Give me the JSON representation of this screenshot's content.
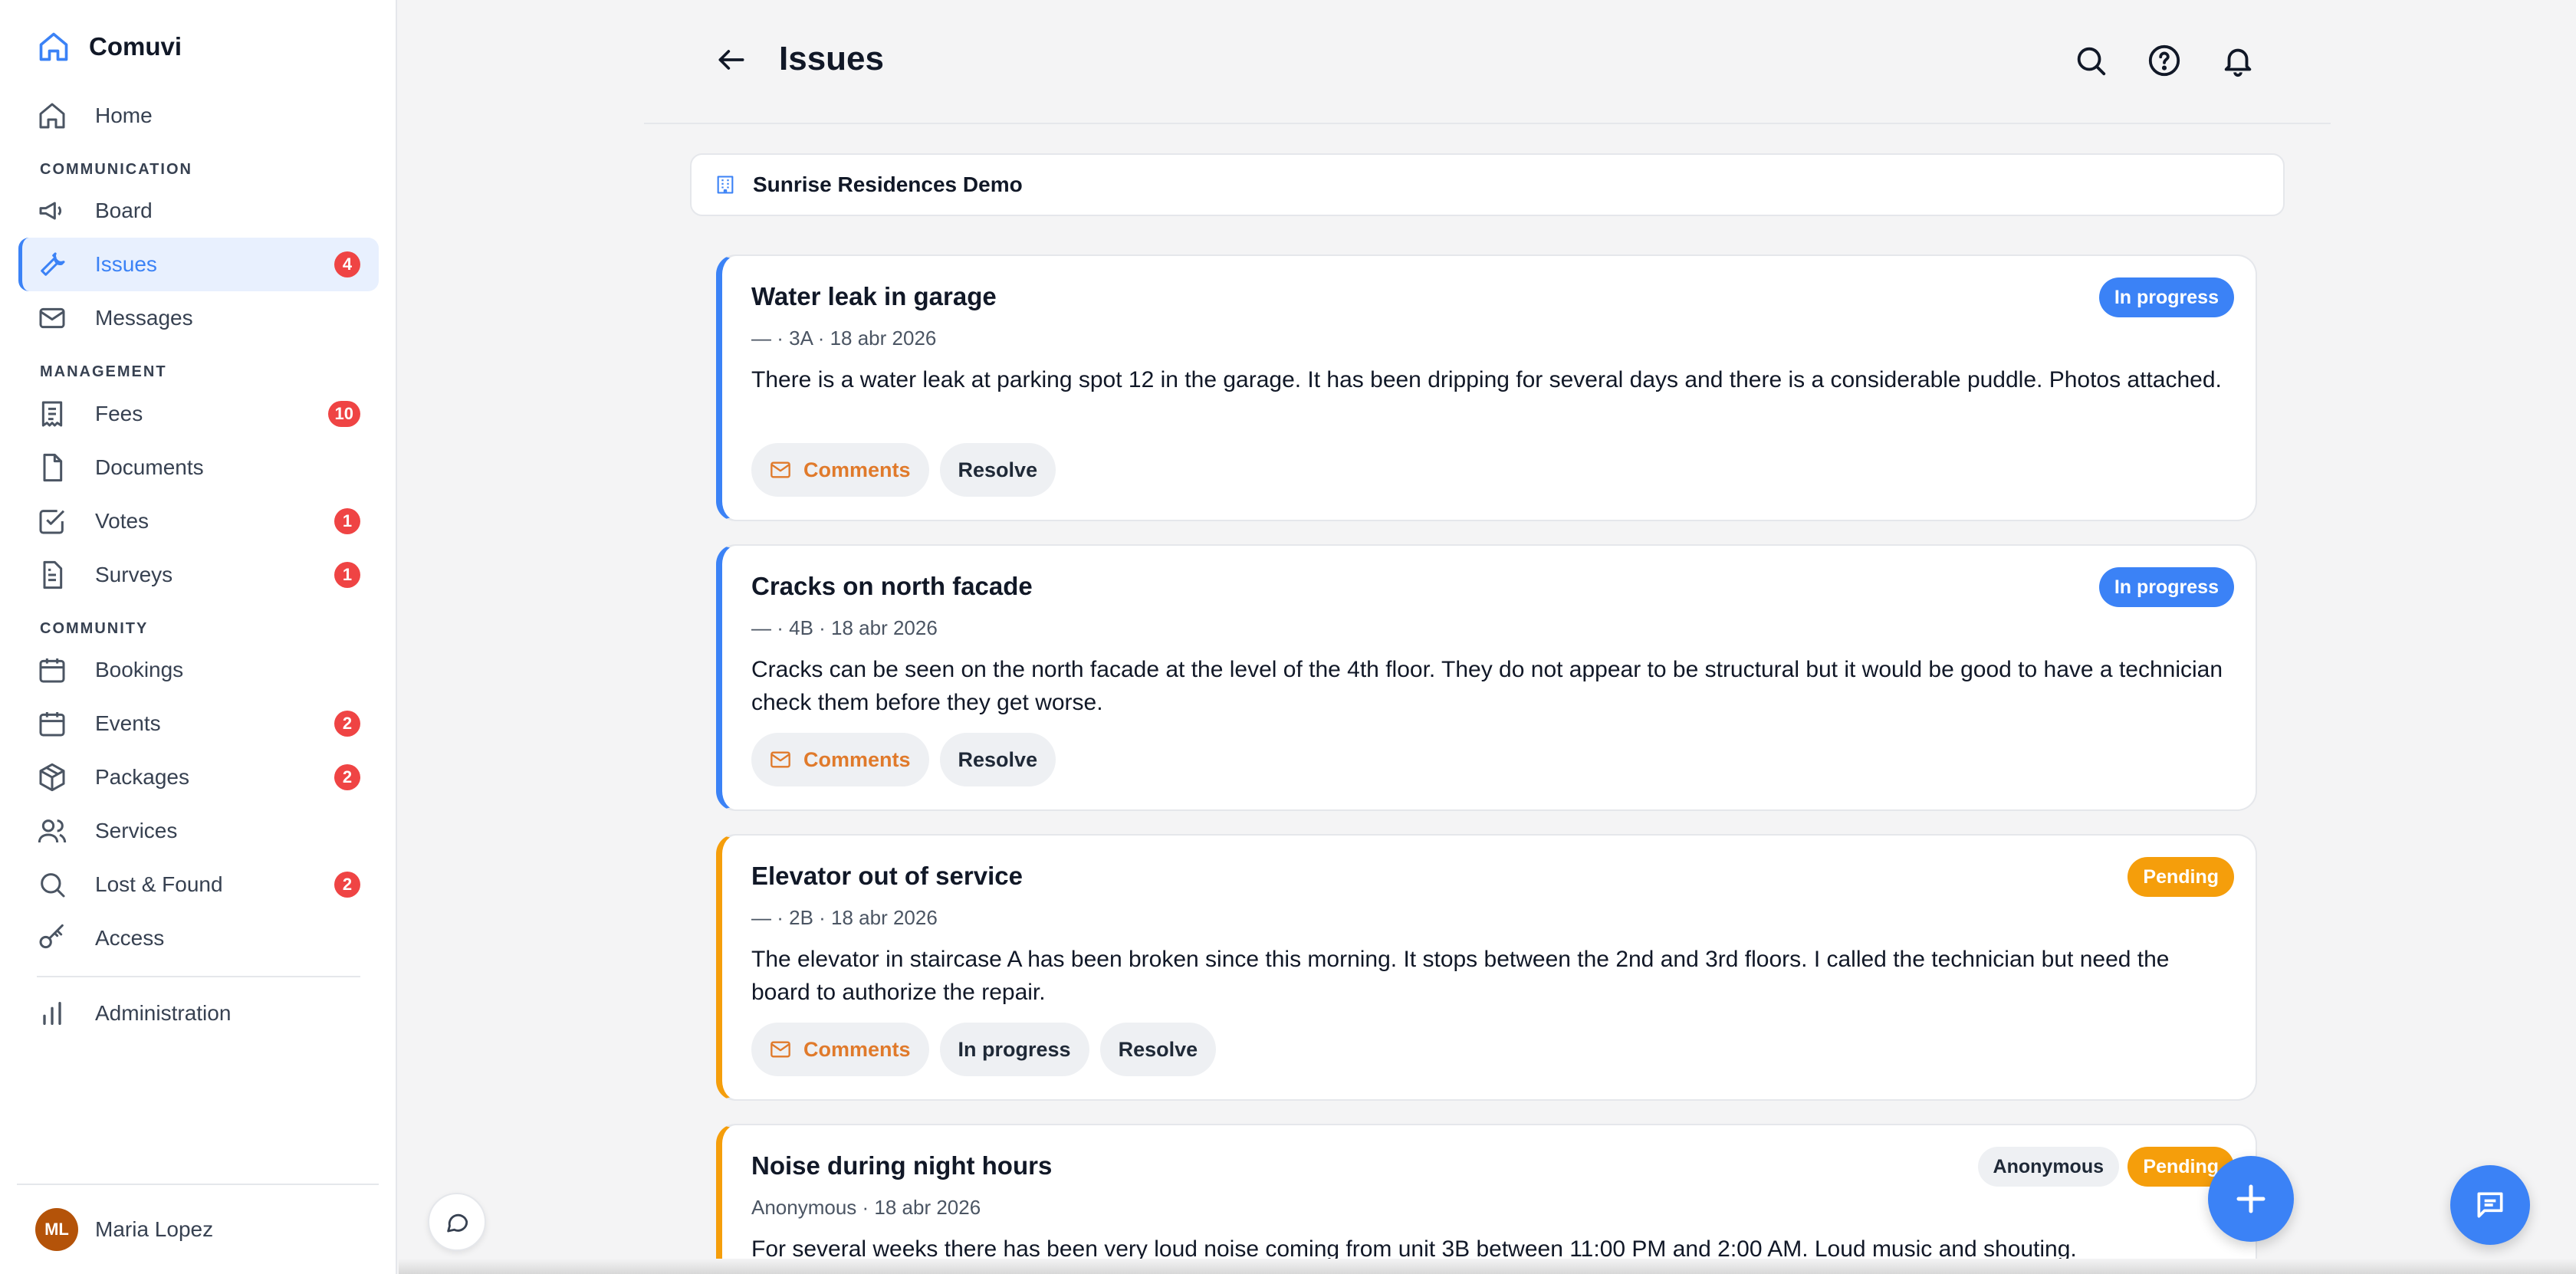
{
  "app": {
    "name": "Comuvi"
  },
  "sidebar": {
    "home": {
      "label": "Home"
    },
    "sections": {
      "communication": "COMMUNICATION",
      "management": "MANAGEMENT",
      "community": "COMMUNITY"
    },
    "items": {
      "board": {
        "label": "Board"
      },
      "issues": {
        "label": "Issues",
        "badge": "4"
      },
      "messages": {
        "label": "Messages"
      },
      "fees": {
        "label": "Fees",
        "badge": "10"
      },
      "documents": {
        "label": "Documents"
      },
      "votes": {
        "label": "Votes",
        "badge": "1"
      },
      "surveys": {
        "label": "Surveys",
        "badge": "1"
      },
      "bookings": {
        "label": "Bookings"
      },
      "events": {
        "label": "Events",
        "badge": "2"
      },
      "packages": {
        "label": "Packages",
        "badge": "2"
      },
      "services": {
        "label": "Services"
      },
      "lostfound": {
        "label": "Lost & Found",
        "badge": "2"
      },
      "access": {
        "label": "Access"
      },
      "administration": {
        "label": "Administration"
      }
    },
    "user": {
      "initials": "ML",
      "name": "Maria Lopez"
    }
  },
  "header": {
    "title": "Issues"
  },
  "community": {
    "name": "Sunrise Residences Demo"
  },
  "issues": [
    {
      "title": "Water leak in garage",
      "meta": "— · 3A · 18 abr 2026",
      "description": "There is a water leak at parking spot 12 in the garage. It has been dripping for several days and there is a considerable puddle. Photos attached.",
      "status": "In progress",
      "actions": {
        "comments": "Comments",
        "resolve": "Resolve"
      }
    },
    {
      "title": "Cracks on north facade",
      "meta": "— · 4B · 18 abr 2026",
      "description": "Cracks can be seen on the north facade at the level of the 4th floor. They do not appear to be structural but it would be good to have a technician check them before they get worse.",
      "status": "In progress",
      "actions": {
        "comments": "Comments",
        "resolve": "Resolve"
      }
    },
    {
      "title": "Elevator out of service",
      "meta": "— · 2B · 18 abr 2026",
      "description": "The elevator in staircase A has been broken since this morning. It stops between the 2nd and 3rd floors. I called the technician but need the board to authorize the repair.",
      "status": "Pending",
      "actions": {
        "comments": "Comments",
        "progress": "In progress",
        "resolve": "Resolve"
      }
    },
    {
      "title": "Noise during night hours",
      "meta": "Anonymous · 18 abr 2026",
      "description": "For several weeks there has been very loud noise coming from unit 3B between 11:00 PM and 2:00 AM. Loud music and shouting.",
      "status": "Pending",
      "tag": "Anonymous"
    }
  ],
  "colors": {
    "accent": "#3b82f6",
    "pending": "#f59e0b",
    "badge": "#ef4444",
    "comments": "#e07a2b"
  }
}
